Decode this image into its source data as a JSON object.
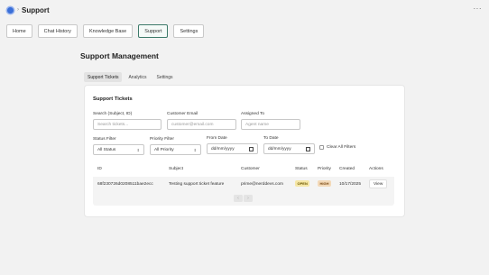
{
  "app": {
    "title": "Support",
    "app_icon": "app-logo-icon",
    "more_icon": "more-horizontal-icon",
    "more_glyph": "···"
  },
  "nav": {
    "items": [
      {
        "label": "Home",
        "active": false
      },
      {
        "label": "Chat History",
        "active": false
      },
      {
        "label": "Knowledge Base",
        "active": false
      },
      {
        "label": "Support",
        "active": true
      },
      {
        "label": "Settings",
        "active": false
      }
    ]
  },
  "page": {
    "title": "Support Management",
    "tabs": [
      {
        "label": "Support Tickets",
        "active": true
      },
      {
        "label": "Analytics",
        "active": false
      },
      {
        "label": "Settings",
        "active": false
      }
    ]
  },
  "tickets": {
    "title": "Support Tickets",
    "filters": {
      "search_label": "Search (Subject, ID)",
      "search_placeholder": "Search tickets...",
      "email_label": "Customer Email",
      "email_placeholder": "customer@email.com",
      "assigned_label": "Assigned To",
      "assigned_placeholder": "Agent name",
      "status_label": "Status Filter",
      "status_value": "All Status",
      "priority_label": "Priority Filter",
      "priority_value": "All Priority",
      "from_label": "From Date",
      "from_value": "dd/mm/yyyy",
      "to_label": "To Date",
      "to_value": "dd/mm/yyyy",
      "clear_label": "Clear All Filters"
    },
    "columns": [
      "ID",
      "Subject",
      "Customer",
      "Status",
      "Priority",
      "Created",
      "Actions"
    ],
    "rows": [
      {
        "id": "68f230726d0208511bae2ecc",
        "subject": "Testing support ticket feature",
        "customer": "prime@nerddevs.com",
        "status": "OPEN",
        "priority": "HIGH",
        "created": "10/17/2025",
        "action": "View"
      }
    ],
    "pager": {
      "prev": "‹",
      "next": "›"
    }
  },
  "colors": {
    "accent": "#3d7a6a",
    "open_badge": "#f6e7a6",
    "high_badge": "#f3d9b8",
    "background": "#f2f2f2"
  }
}
